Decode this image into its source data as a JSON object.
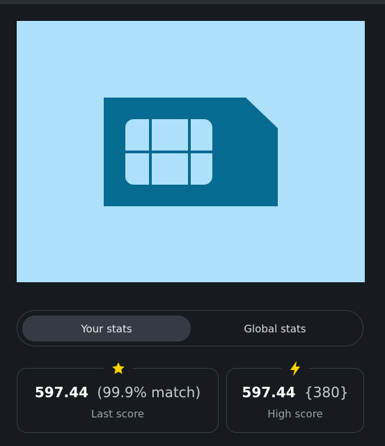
{
  "tabs": {
    "your_stats": "Your stats",
    "global_stats": "Global stats"
  },
  "stats": {
    "last": {
      "icon": "star-icon",
      "score": "597.44",
      "extra": "(99.9% match)",
      "label": "Last score"
    },
    "high": {
      "icon": "lightning-icon",
      "score": "597.44",
      "extra": "{380}",
      "label": "High score"
    }
  },
  "colors": {
    "preview_bg": "#ace0fb",
    "sim_card": "#086b91",
    "accent_yellow": "#ffd400"
  }
}
